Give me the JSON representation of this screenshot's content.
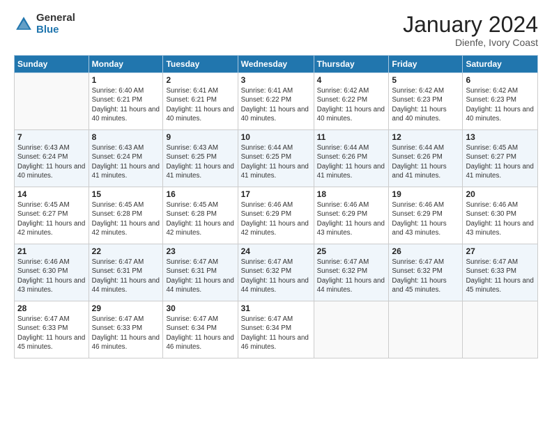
{
  "header": {
    "logo_general": "General",
    "logo_blue": "Blue",
    "month_title": "January 2024",
    "location": "Dienfe, Ivory Coast"
  },
  "days_of_week": [
    "Sunday",
    "Monday",
    "Tuesday",
    "Wednesday",
    "Thursday",
    "Friday",
    "Saturday"
  ],
  "weeks": [
    [
      {
        "day": "",
        "sunrise": "",
        "sunset": "",
        "daylight": ""
      },
      {
        "day": "1",
        "sunrise": "Sunrise: 6:40 AM",
        "sunset": "Sunset: 6:21 PM",
        "daylight": "Daylight: 11 hours and 40 minutes."
      },
      {
        "day": "2",
        "sunrise": "Sunrise: 6:41 AM",
        "sunset": "Sunset: 6:21 PM",
        "daylight": "Daylight: 11 hours and 40 minutes."
      },
      {
        "day": "3",
        "sunrise": "Sunrise: 6:41 AM",
        "sunset": "Sunset: 6:22 PM",
        "daylight": "Daylight: 11 hours and 40 minutes."
      },
      {
        "day": "4",
        "sunrise": "Sunrise: 6:42 AM",
        "sunset": "Sunset: 6:22 PM",
        "daylight": "Daylight: 11 hours and 40 minutes."
      },
      {
        "day": "5",
        "sunrise": "Sunrise: 6:42 AM",
        "sunset": "Sunset: 6:23 PM",
        "daylight": "Daylight: 11 hours and 40 minutes."
      },
      {
        "day": "6",
        "sunrise": "Sunrise: 6:42 AM",
        "sunset": "Sunset: 6:23 PM",
        "daylight": "Daylight: 11 hours and 40 minutes."
      }
    ],
    [
      {
        "day": "7",
        "sunrise": "Sunrise: 6:43 AM",
        "sunset": "Sunset: 6:24 PM",
        "daylight": "Daylight: 11 hours and 40 minutes."
      },
      {
        "day": "8",
        "sunrise": "Sunrise: 6:43 AM",
        "sunset": "Sunset: 6:24 PM",
        "daylight": "Daylight: 11 hours and 41 minutes."
      },
      {
        "day": "9",
        "sunrise": "Sunrise: 6:43 AM",
        "sunset": "Sunset: 6:25 PM",
        "daylight": "Daylight: 11 hours and 41 minutes."
      },
      {
        "day": "10",
        "sunrise": "Sunrise: 6:44 AM",
        "sunset": "Sunset: 6:25 PM",
        "daylight": "Daylight: 11 hours and 41 minutes."
      },
      {
        "day": "11",
        "sunrise": "Sunrise: 6:44 AM",
        "sunset": "Sunset: 6:26 PM",
        "daylight": "Daylight: 11 hours and 41 minutes."
      },
      {
        "day": "12",
        "sunrise": "Sunrise: 6:44 AM",
        "sunset": "Sunset: 6:26 PM",
        "daylight": "Daylight: 11 hours and 41 minutes."
      },
      {
        "day": "13",
        "sunrise": "Sunrise: 6:45 AM",
        "sunset": "Sunset: 6:27 PM",
        "daylight": "Daylight: 11 hours and 41 minutes."
      }
    ],
    [
      {
        "day": "14",
        "sunrise": "Sunrise: 6:45 AM",
        "sunset": "Sunset: 6:27 PM",
        "daylight": "Daylight: 11 hours and 42 minutes."
      },
      {
        "day": "15",
        "sunrise": "Sunrise: 6:45 AM",
        "sunset": "Sunset: 6:28 PM",
        "daylight": "Daylight: 11 hours and 42 minutes."
      },
      {
        "day": "16",
        "sunrise": "Sunrise: 6:45 AM",
        "sunset": "Sunset: 6:28 PM",
        "daylight": "Daylight: 11 hours and 42 minutes."
      },
      {
        "day": "17",
        "sunrise": "Sunrise: 6:46 AM",
        "sunset": "Sunset: 6:29 PM",
        "daylight": "Daylight: 11 hours and 42 minutes."
      },
      {
        "day": "18",
        "sunrise": "Sunrise: 6:46 AM",
        "sunset": "Sunset: 6:29 PM",
        "daylight": "Daylight: 11 hours and 43 minutes."
      },
      {
        "day": "19",
        "sunrise": "Sunrise: 6:46 AM",
        "sunset": "Sunset: 6:29 PM",
        "daylight": "Daylight: 11 hours and 43 minutes."
      },
      {
        "day": "20",
        "sunrise": "Sunrise: 6:46 AM",
        "sunset": "Sunset: 6:30 PM",
        "daylight": "Daylight: 11 hours and 43 minutes."
      }
    ],
    [
      {
        "day": "21",
        "sunrise": "Sunrise: 6:46 AM",
        "sunset": "Sunset: 6:30 PM",
        "daylight": "Daylight: 11 hours and 43 minutes."
      },
      {
        "day": "22",
        "sunrise": "Sunrise: 6:47 AM",
        "sunset": "Sunset: 6:31 PM",
        "daylight": "Daylight: 11 hours and 44 minutes."
      },
      {
        "day": "23",
        "sunrise": "Sunrise: 6:47 AM",
        "sunset": "Sunset: 6:31 PM",
        "daylight": "Daylight: 11 hours and 44 minutes."
      },
      {
        "day": "24",
        "sunrise": "Sunrise: 6:47 AM",
        "sunset": "Sunset: 6:32 PM",
        "daylight": "Daylight: 11 hours and 44 minutes."
      },
      {
        "day": "25",
        "sunrise": "Sunrise: 6:47 AM",
        "sunset": "Sunset: 6:32 PM",
        "daylight": "Daylight: 11 hours and 44 minutes."
      },
      {
        "day": "26",
        "sunrise": "Sunrise: 6:47 AM",
        "sunset": "Sunset: 6:32 PM",
        "daylight": "Daylight: 11 hours and 45 minutes."
      },
      {
        "day": "27",
        "sunrise": "Sunrise: 6:47 AM",
        "sunset": "Sunset: 6:33 PM",
        "daylight": "Daylight: 11 hours and 45 minutes."
      }
    ],
    [
      {
        "day": "28",
        "sunrise": "Sunrise: 6:47 AM",
        "sunset": "Sunset: 6:33 PM",
        "daylight": "Daylight: 11 hours and 45 minutes."
      },
      {
        "day": "29",
        "sunrise": "Sunrise: 6:47 AM",
        "sunset": "Sunset: 6:33 PM",
        "daylight": "Daylight: 11 hours and 46 minutes."
      },
      {
        "day": "30",
        "sunrise": "Sunrise: 6:47 AM",
        "sunset": "Sunset: 6:34 PM",
        "daylight": "Daylight: 11 hours and 46 minutes."
      },
      {
        "day": "31",
        "sunrise": "Sunrise: 6:47 AM",
        "sunset": "Sunset: 6:34 PM",
        "daylight": "Daylight: 11 hours and 46 minutes."
      },
      {
        "day": "",
        "sunrise": "",
        "sunset": "",
        "daylight": ""
      },
      {
        "day": "",
        "sunrise": "",
        "sunset": "",
        "daylight": ""
      },
      {
        "day": "",
        "sunrise": "",
        "sunset": "",
        "daylight": ""
      }
    ]
  ]
}
